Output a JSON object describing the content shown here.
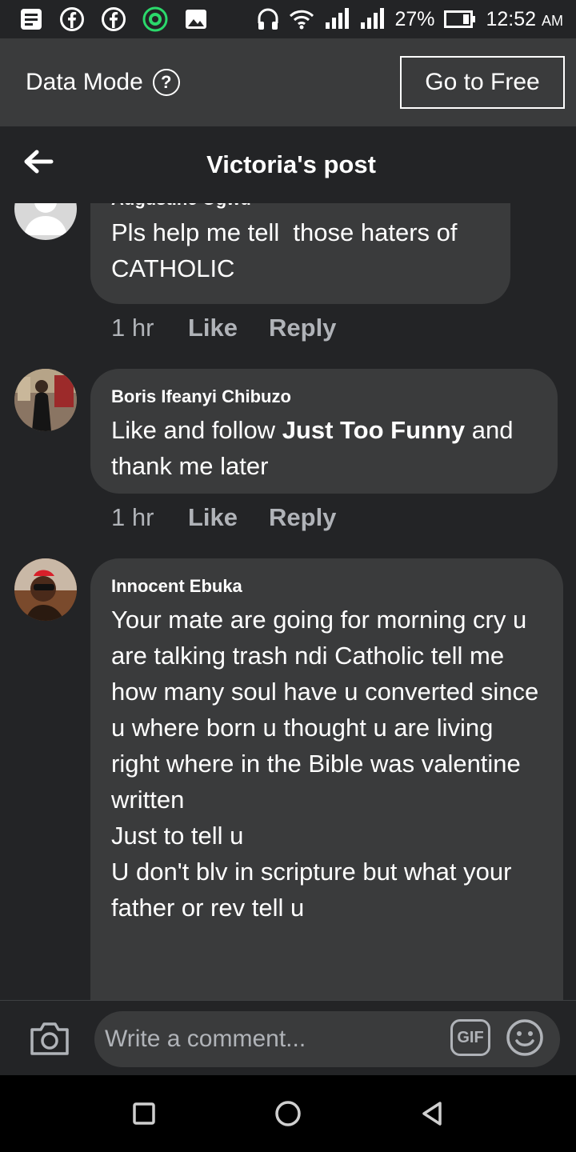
{
  "status_bar": {
    "left_icons": [
      "notes-icon",
      "facebook-icon",
      "facebook-icon",
      "whatsapp-business-icon",
      "gallery-icon"
    ],
    "battery_percent": "27%",
    "time": "12:52",
    "time_suffix": "AM"
  },
  "data_mode": {
    "label": "Data Mode",
    "help_glyph": "?",
    "cta": "Go to Free"
  },
  "nav": {
    "title": "Victoria's post"
  },
  "comments": [
    {
      "author": "Augustine Ogwu",
      "text": "Pls help me tell  those haters of CATHOLIC",
      "time": "1 hr",
      "like": "Like",
      "reply": "Reply"
    },
    {
      "author": "Boris Ifeanyi Chibuzo",
      "text_before": "Like and follow ",
      "text_bold": "Just Too Funny",
      "text_after": " and thank me later",
      "time": "1 hr",
      "like": "Like",
      "reply": "Reply"
    },
    {
      "author": "Innocent Ebuka",
      "text": "Your mate are going for morning cry u are talking trash ndi Catholic tell me how many soul have u converted since u where born u thought u are living right where in the Bible was valentine written\nJust to tell u\nU don't blv in scripture but what your father or rev tell u"
    }
  ],
  "composer": {
    "placeholder": "Write a comment...",
    "gif_label": "GIF"
  },
  "colors": {
    "background": "#232426",
    "bubble": "#3a3b3c",
    "secondary_text": "#b0b3b8"
  }
}
